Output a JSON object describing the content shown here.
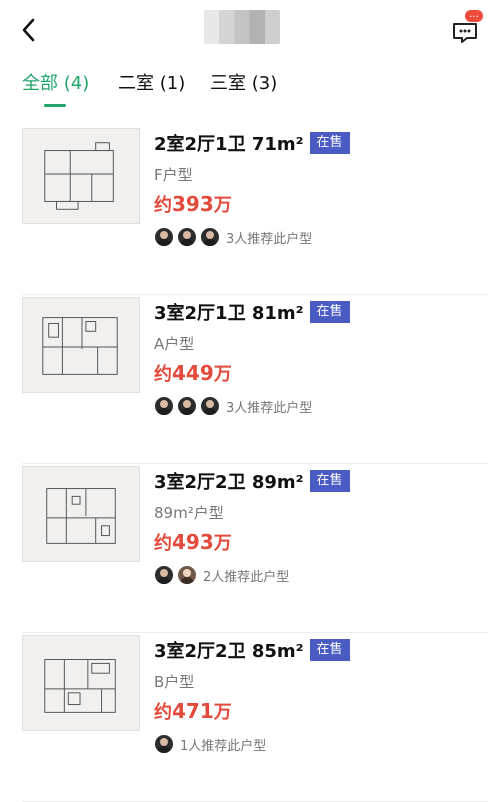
{
  "header": {
    "title": "",
    "message_badge": "..."
  },
  "tabs": [
    {
      "label": "全部 (4)",
      "active": true
    },
    {
      "label": "二室 (1)",
      "active": false
    },
    {
      "label": "三室 (3)",
      "active": false
    }
  ],
  "items": [
    {
      "spec": "2室2厅1卫 71m²",
      "status": "在售",
      "type": "F户型",
      "price_prefix": "约",
      "price": "393",
      "price_unit": "万",
      "recommend": "3人推荐此户型",
      "avatars": 3
    },
    {
      "spec": "3室2厅1卫 81m²",
      "status": "在售",
      "type": "A户型",
      "price_prefix": "约",
      "price": "449",
      "price_unit": "万",
      "recommend": "3人推荐此户型",
      "avatars": 3
    },
    {
      "spec": "3室2厅2卫 89m²",
      "status": "在售",
      "type": "89m²户型",
      "price_prefix": "约",
      "price": "493",
      "price_unit": "万",
      "recommend": "2人推荐此户型",
      "avatars": 2
    },
    {
      "spec": "3室2厅2卫 85m²",
      "status": "在售",
      "type": "B户型",
      "price_prefix": "约",
      "price": "471",
      "price_unit": "万",
      "recommend": "1人推荐此户型",
      "avatars": 1
    }
  ],
  "colors": {
    "accent": "#21a56b",
    "badge": "#4a5bc3",
    "price": "#e24a3b"
  }
}
